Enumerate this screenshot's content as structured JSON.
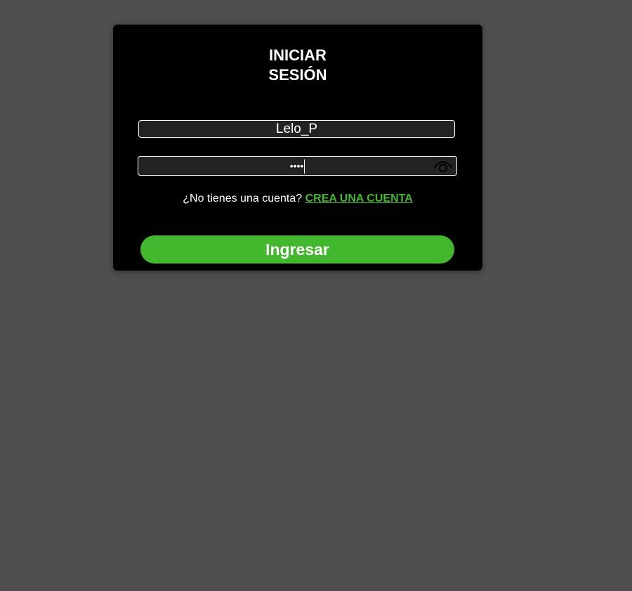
{
  "login": {
    "title_line1": "INICIAR",
    "title_line2": "SESIÓN",
    "username_value": "Lelo_P",
    "password_masked": "••••",
    "signup_prompt": "¿No tienes una cuenta?",
    "signup_link": "CREA UNA CUENTA",
    "submit_label": "Ingresar"
  },
  "icons": {
    "toggle_password": "eye-icon"
  },
  "colors": {
    "page_bg": "#4f4f4f",
    "card_bg": "#000000",
    "field_bg": "#232323",
    "accent": "#42b82e",
    "text": "#ffffff"
  }
}
